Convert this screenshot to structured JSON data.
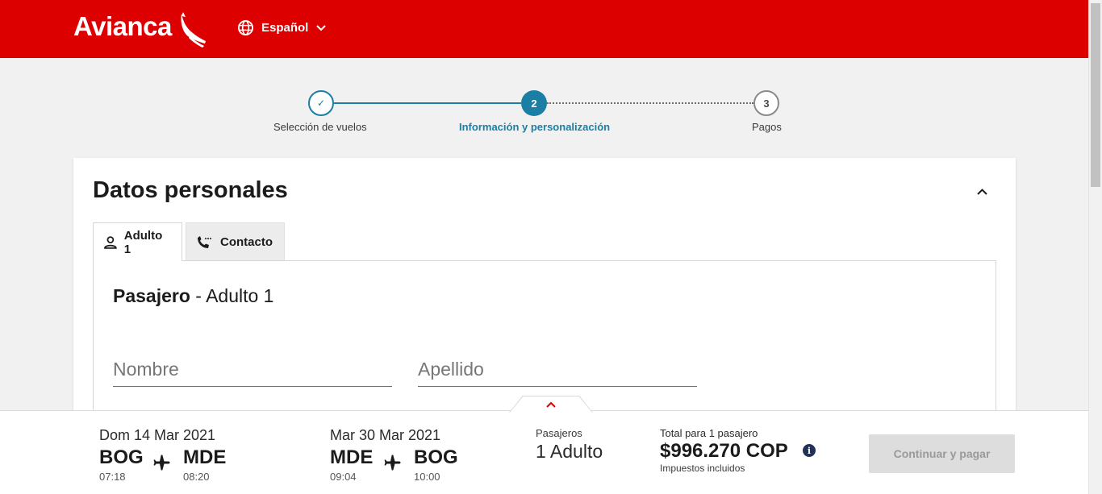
{
  "header": {
    "brand": "Avianca",
    "language": "Español",
    "colors": {
      "brand_red": "#dc0000",
      "accent": "#1b7ea5"
    }
  },
  "stepper": {
    "steps": [
      {
        "number": "✓",
        "label": "Selección de vuelos",
        "state": "done"
      },
      {
        "number": "2",
        "label": "Información y personalización",
        "state": "current"
      },
      {
        "number": "3",
        "label": "Pagos",
        "state": "pending"
      }
    ]
  },
  "section": {
    "title": "Datos personales",
    "tabs": [
      {
        "label": "Adulto 1",
        "icon": "person-icon",
        "active": true
      },
      {
        "label": "Contacto",
        "icon": "phone-icon",
        "active": false
      }
    ],
    "passenger_heading_bold": "Pasajero",
    "passenger_heading_rest": " - Adulto 1",
    "fields": {
      "first_name": {
        "placeholder": "Nombre",
        "value": ""
      },
      "last_name": {
        "placeholder": "Apellido",
        "value": ""
      }
    }
  },
  "summary": {
    "outbound": {
      "date": "Dom 14 Mar 2021",
      "from": "BOG",
      "from_time": "07:18",
      "to": "MDE",
      "to_time": "08:20"
    },
    "return": {
      "date": "Mar 30 Mar 2021",
      "from": "MDE",
      "from_time": "09:04",
      "to": "BOG",
      "to_time": "10:00"
    },
    "passengers_label": "Pasajeros",
    "passengers_value": "1 Adulto",
    "total_label": "Total para 1 pasajero",
    "total_price": "$996.270 COP",
    "taxes_note": "Impuestos incluidos",
    "info_glyph": "i",
    "pay_button": "Continuar y pagar"
  }
}
